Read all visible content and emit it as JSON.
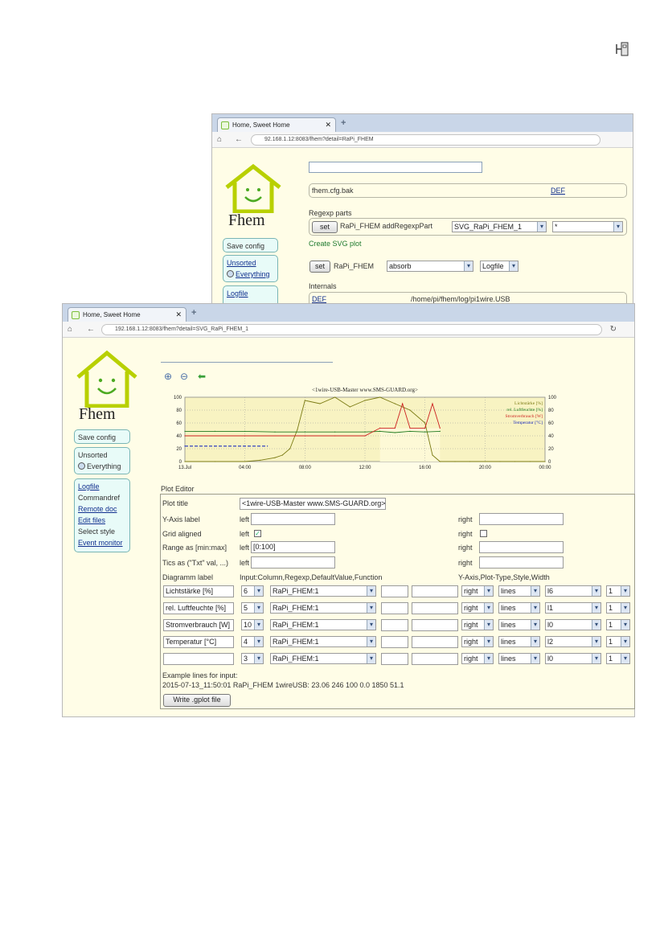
{
  "top_icon": "usb-plug-icon",
  "back_window": {
    "tab_title": "Home, Sweet Home",
    "url": "92.168.1.12:8083/fhem?detail=RaPi_FHEM",
    "logo": "Fhem",
    "menu": {
      "save_config": "Save config",
      "unsorted": "Unsorted",
      "everything": "Everything",
      "logfile": "Logfile"
    },
    "ident": "fhem.cfg.bak",
    "ident_link": "DEF",
    "regexp_parts_label": "Regexp parts",
    "set_button": "set",
    "add_regexp_text": "RaPi_FHEM addRegexpPart",
    "regexp_select": "SVG_RaPi_FHEM_1",
    "regexp_select2": "*",
    "create_svg": "Create SVG plot",
    "set_button2": "set",
    "device_name": "RaPi_FHEM",
    "absorb_select": "absorb",
    "logfile_select": "Logfile",
    "internals_label": "Internals",
    "internals_key": "DEF",
    "internals_value": "/home/pi/fhem/log/pi1wire.USB"
  },
  "front_window": {
    "tab_title": "Home, Sweet Home",
    "url": "192.168.1.12:8083/fhem?detail=SVG_RaPi_FHEM_1",
    "logo": "Fhem",
    "menu": {
      "save_config": "Save config",
      "unsorted": "Unsorted",
      "everything": "Everything",
      "logfile": "Logfile",
      "commandref": "Commandref",
      "remote_doc": "Remote doc",
      "edit_files": "Edit files",
      "select_style": "Select style",
      "event_monitor": "Event monitor"
    },
    "icons": [
      "zoom-in-icon",
      "zoom-out-icon",
      "back-arrow-icon"
    ]
  },
  "chart_data": {
    "type": "line",
    "title": "<1wire-USB-Master www.SMS-GUARD.org>",
    "x_ticks": [
      "13.Jul",
      "04:00",
      "08:00",
      "12:00",
      "16:00",
      "20:00",
      "00:00"
    ],
    "y_left_ticks": [
      "0",
      "20",
      "40",
      "60",
      "80",
      "100"
    ],
    "y_right_ticks": [
      "0",
      "20",
      "40",
      "60",
      "80",
      "100"
    ],
    "ylim": [
      0,
      100
    ],
    "grid": true,
    "legend_position": "top-right",
    "legend": [
      "Lichtstärke [%]",
      "rel. Luftfeuchte [%]",
      "Stromverbrauch [W]",
      "Temperatur [°C]"
    ],
    "colors": [
      "#7a7a12",
      "#1f7a1f",
      "#cc1f1f",
      "#1f2fbf"
    ],
    "series": [
      {
        "name": "Lichtstärke [%]",
        "x": [
          0,
          2,
          4,
          5,
          6,
          6.5,
          7,
          7.5,
          8,
          9,
          10,
          11,
          12,
          13,
          14,
          15,
          16,
          16.5,
          17,
          18,
          19,
          20,
          21,
          22,
          23,
          24
        ],
        "values": [
          0,
          0,
          0,
          2,
          6,
          10,
          20,
          50,
          95,
          90,
          100,
          85,
          95,
          100,
          90,
          80,
          60,
          10,
          0,
          0,
          0,
          0,
          0,
          0,
          0,
          0
        ]
      },
      {
        "name": "rel. Luftfeuchte [%]",
        "x": [
          0,
          2,
          4,
          6,
          8,
          10,
          12,
          13,
          14,
          15,
          16,
          17
        ],
        "values": [
          47,
          47,
          47,
          46,
          46,
          46,
          46,
          47,
          45,
          47,
          46,
          47
        ]
      },
      {
        "name": "Stromverbrauch [W]",
        "x": [
          0,
          4,
          8,
          10,
          12,
          13,
          14,
          14.5,
          15,
          16,
          16.5,
          17
        ],
        "values": [
          40,
          40,
          40,
          40,
          40,
          52,
          52,
          90,
          52,
          52,
          90,
          52
        ]
      },
      {
        "name": "Temperatur [°C]",
        "x": [
          0,
          2,
          4,
          5.5
        ],
        "values": [
          24,
          24,
          24,
          24
        ]
      }
    ]
  },
  "plot_editor": {
    "heading": "Plot Editor",
    "plot_title_label": "Plot title",
    "plot_title_value": "<1wire-USB-Master www.SMS-GUARD.org>",
    "y_axis_label": "Y-Axis label",
    "grid_aligned_label": "Grid aligned",
    "range_label": "Range as [min:max]",
    "tics_label": "Tics as (\"Txt\" val, ...)",
    "left": "left",
    "right": "right",
    "range_left_value": "[0:100]",
    "diagram_label_header": "Diagramm label",
    "input_column_header": "Input:Column,Regexp,DefaultValue,Function",
    "y_axis_header": "Y-Axis,Plot-Type,Style,Width",
    "rows": [
      {
        "label": "Lichtstärke [%]",
        "column": "6",
        "regexp": "RaPi_FHEM:1",
        "axis": "right",
        "type": "lines",
        "style": "l6",
        "width": "1"
      },
      {
        "label": "rel. Luftfeuchte [%]",
        "column": "5",
        "regexp": "RaPi_FHEM:1",
        "axis": "right",
        "type": "lines",
        "style": "l1",
        "width": "1"
      },
      {
        "label": "Stromverbrauch [W]",
        "column": "10",
        "regexp": "RaPi_FHEM:1",
        "axis": "right",
        "type": "lines",
        "style": "l0",
        "width": "1"
      },
      {
        "label": "Temperatur [°C]",
        "column": "4",
        "regexp": "RaPi_FHEM:1",
        "axis": "right",
        "type": "lines",
        "style": "l2",
        "width": "1"
      },
      {
        "label": "",
        "column": "3",
        "regexp": "RaPi_FHEM:1",
        "axis": "right",
        "type": "lines",
        "style": "l0",
        "width": "1"
      }
    ],
    "example_label": "Example lines for input:",
    "example_line": "2015-07-13_11:50:01 RaPi_FHEM 1wireUSB: 23.06 246 100 0.0 1850 51.1",
    "write_button": "Write .gplot file"
  }
}
